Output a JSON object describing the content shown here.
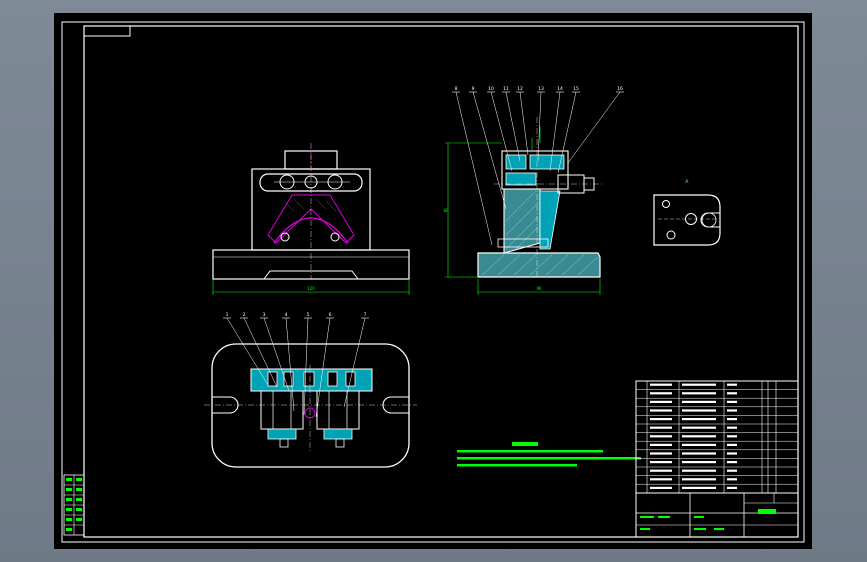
{
  "colors": {
    "background": "#000000",
    "outline": "#ffffff",
    "part": "#00a3b5",
    "section": "#d800d8",
    "dimension": "#00ff00",
    "leader": "#ffffff",
    "notes": "#00ff00",
    "hatch": "#5fb0b8"
  },
  "callouts": {
    "side_view": [
      "8",
      "9",
      "10",
      "11",
      "12",
      "13",
      "14",
      "15",
      "16"
    ],
    "plan_view": [
      "1",
      "2",
      "3",
      "4",
      "5",
      "6",
      "7"
    ]
  },
  "detail_view": {
    "label": "A"
  },
  "dimensions": {
    "front_width": "120",
    "side_width": "96",
    "side_height": "80"
  }
}
